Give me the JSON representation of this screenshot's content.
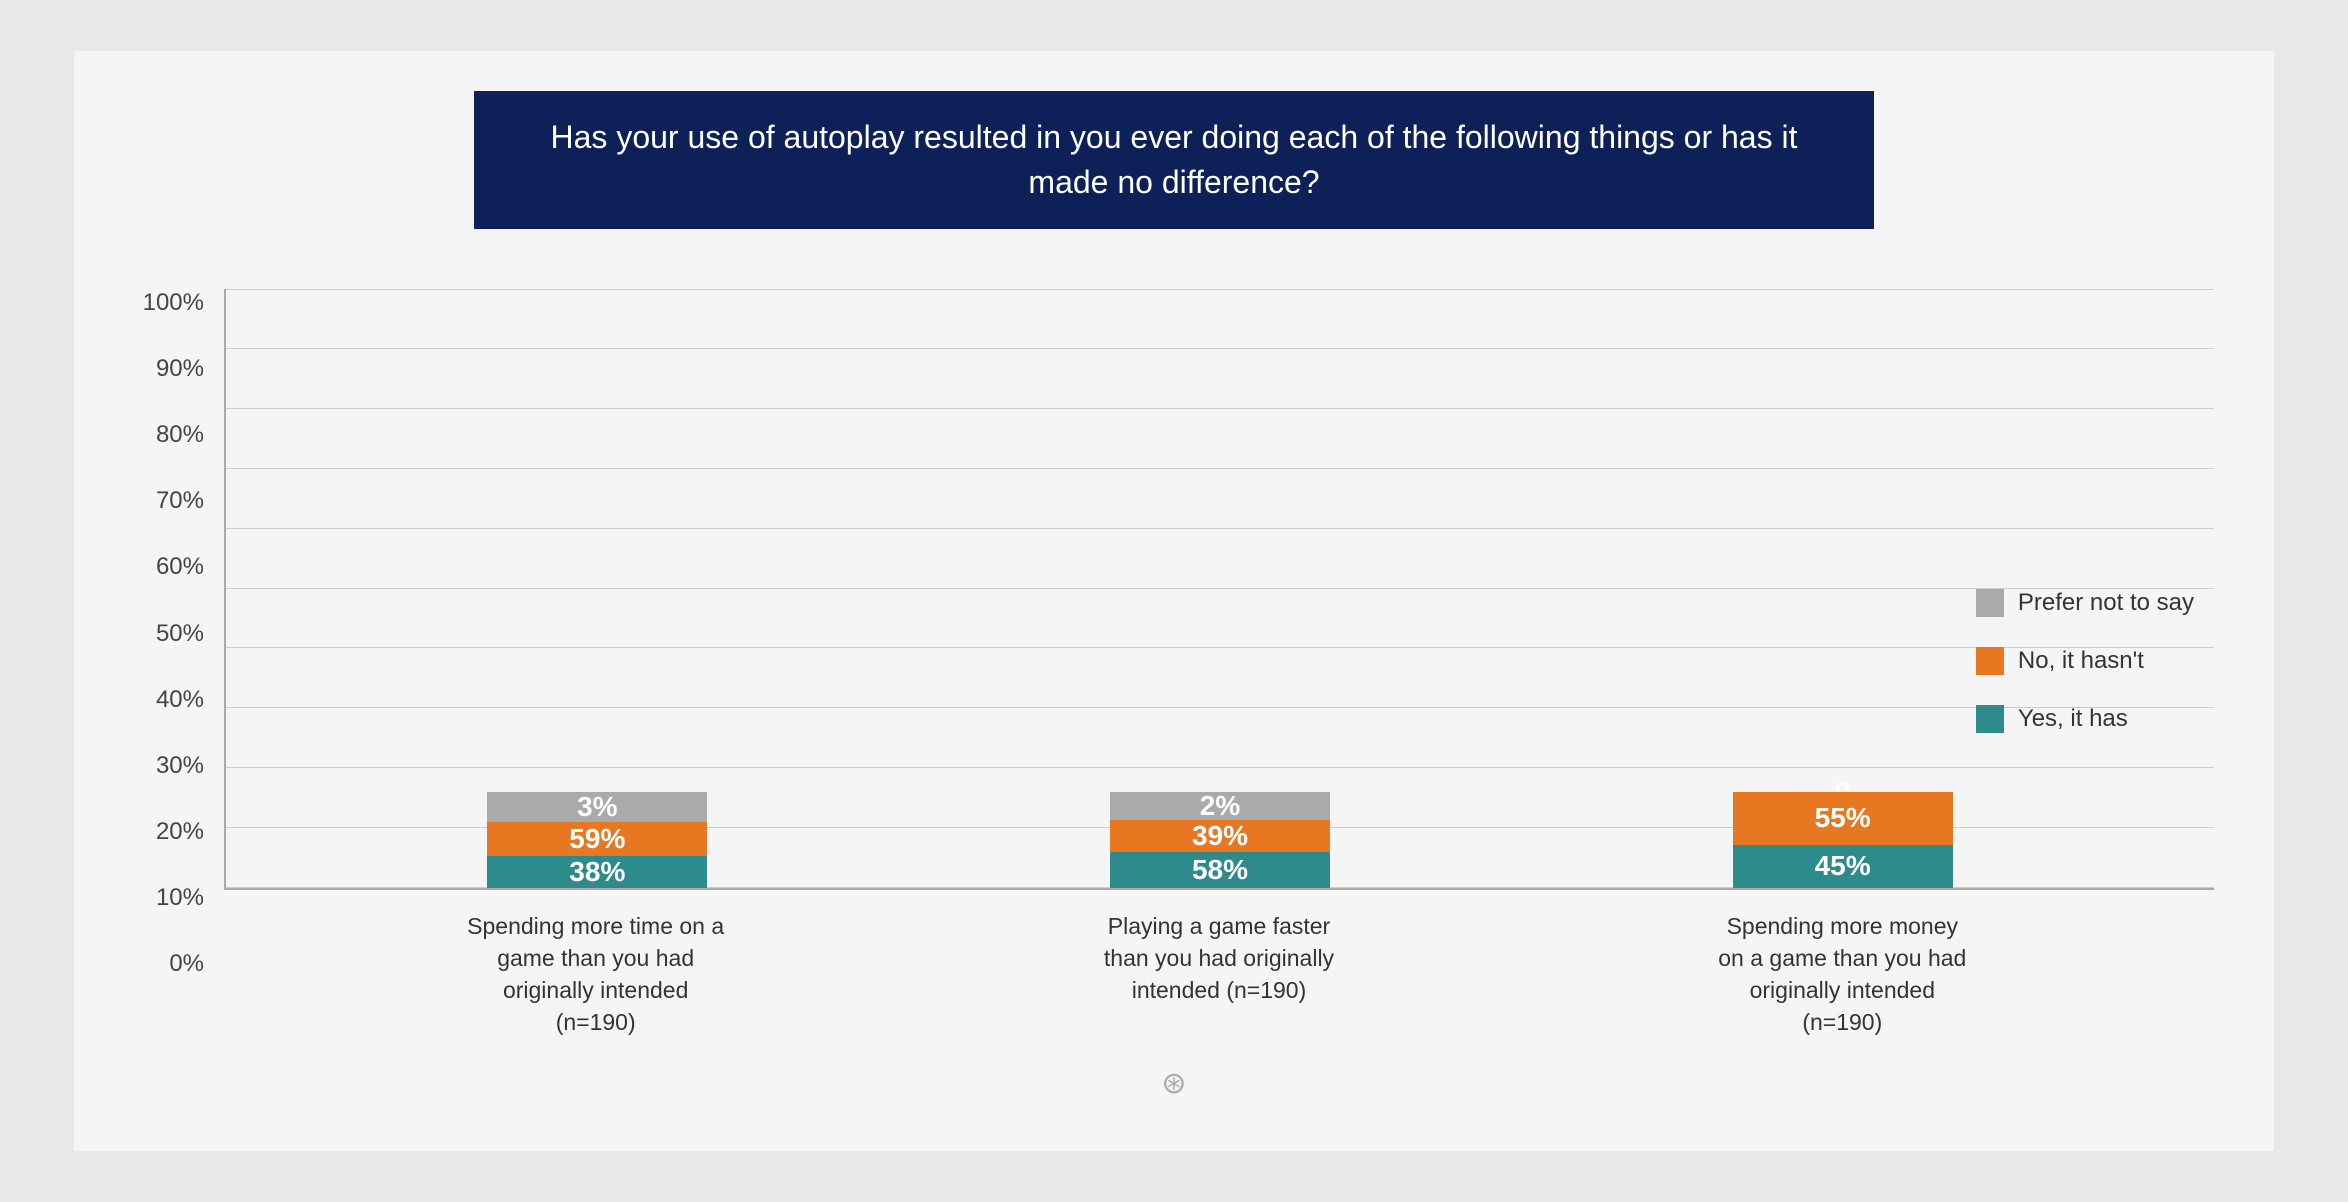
{
  "title": "Has your use of autoplay resulted in you ever doing each of the following things or has it made no difference?",
  "yAxis": {
    "labels": [
      "100%",
      "90%",
      "80%",
      "70%",
      "60%",
      "50%",
      "40%",
      "30%",
      "20%",
      "10%",
      "0%"
    ]
  },
  "bars": [
    {
      "id": "bar1",
      "label": "Spending more time on a game than you had originally intended\n(n=190)",
      "segments": {
        "prefer": 3,
        "no": 59,
        "yes": 38
      }
    },
    {
      "id": "bar2",
      "label": "Playing a game faster than you had originally intended\n(n=190)",
      "segments": {
        "prefer": 2,
        "no": 39,
        "yes": 58
      }
    },
    {
      "id": "bar3",
      "label": "Spending more money on a game than you had originally intended\n(n=190)",
      "segments": {
        "prefer": 0,
        "no": 55,
        "yes": 45
      }
    }
  ],
  "legend": [
    {
      "key": "prefer",
      "label": "Prefer not to say",
      "color": "#aaaaaa"
    },
    {
      "key": "no",
      "label": "No, it hasn't",
      "color": "#e87722"
    },
    {
      "key": "yes",
      "label": "Yes, it has",
      "color": "#2e8b8b"
    }
  ],
  "xLabels": [
    "Spending more time on a game than you had originally intended (n=190)",
    "Playing a game faster than you had originally intended (n=190)",
    "Spending more money on a game than you had originally intended (n=190)"
  ]
}
